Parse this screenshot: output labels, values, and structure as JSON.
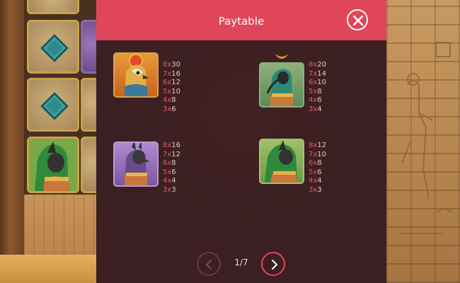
{
  "modal": {
    "title": "Paytable",
    "close_icon": "close-icon"
  },
  "symbols": [
    {
      "name": "Falcon god",
      "payouts": [
        {
          "count": "8x",
          "value": "30"
        },
        {
          "count": "7x",
          "value": "16"
        },
        {
          "count": "6x",
          "value": "12"
        },
        {
          "count": "5x",
          "value": "10"
        },
        {
          "count": "4x",
          "value": "8"
        },
        {
          "count": "3x",
          "value": "6"
        }
      ]
    },
    {
      "name": "Ibis god",
      "payouts": [
        {
          "count": "8x",
          "value": "20"
        },
        {
          "count": "7x",
          "value": "14"
        },
        {
          "count": "6x",
          "value": "10"
        },
        {
          "count": "5x",
          "value": "8"
        },
        {
          "count": "4x",
          "value": "6"
        },
        {
          "count": "3x",
          "value": "4"
        }
      ]
    },
    {
      "name": "Jackal god",
      "payouts": [
        {
          "count": "8x",
          "value": "16"
        },
        {
          "count": "7x",
          "value": "12"
        },
        {
          "count": "6x",
          "value": "8"
        },
        {
          "count": "5x",
          "value": "6"
        },
        {
          "count": "4x",
          "value": "4"
        },
        {
          "count": "3x",
          "value": "3"
        }
      ]
    },
    {
      "name": "Cat goddess",
      "payouts": [
        {
          "count": "8x",
          "value": "12"
        },
        {
          "count": "7x",
          "value": "10"
        },
        {
          "count": "6x",
          "value": "8"
        },
        {
          "count": "5x",
          "value": "6"
        },
        {
          "count": "4x",
          "value": "4"
        },
        {
          "count": "3x",
          "value": "3"
        }
      ]
    }
  ],
  "pager": {
    "current": "1/7",
    "prev_icon": "chevron-left-icon",
    "next_icon": "chevron-right-icon"
  },
  "colors": {
    "accent": "#e04659",
    "panel": "#3b1f22",
    "count_text": "#e35a63",
    "value_text": "#d9cfc6"
  }
}
